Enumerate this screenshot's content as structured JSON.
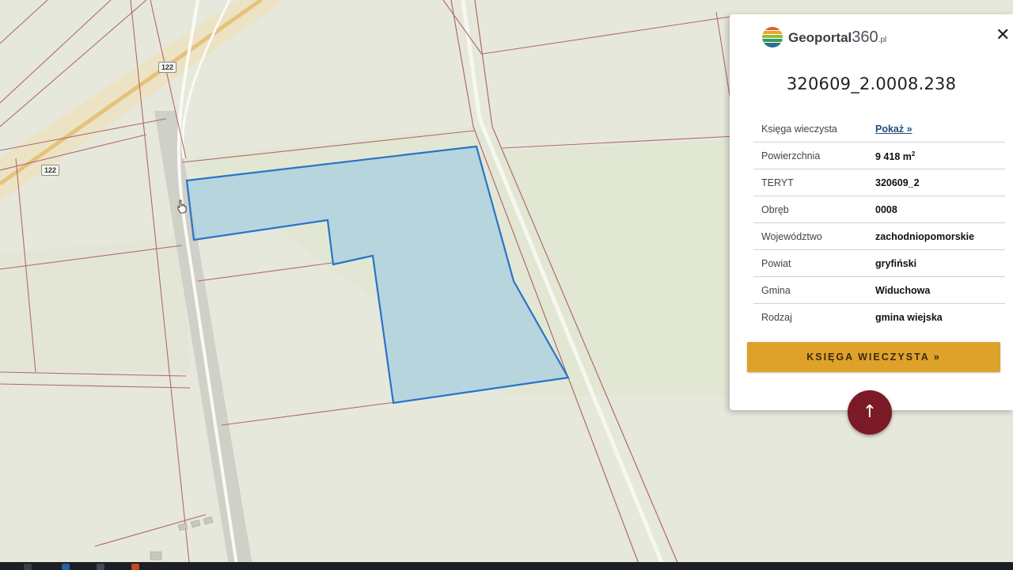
{
  "map": {
    "road_number": "122",
    "colors": {
      "land": "#e7e9dc",
      "field": "#e1e6d2",
      "parcel_line": "#b06a72",
      "road_fill": "#cfcfc8",
      "road_white": "#fbfbf7",
      "main_road": "#e9c98a",
      "selection_fill": "#a7cfe0",
      "selection_stroke": "#2a73c8"
    }
  },
  "panel": {
    "logo": {
      "name": "Geoportal",
      "suffix": "360",
      "tld": ".pl"
    },
    "close_icon": "close-icon",
    "parcel_id": "320609_2.0008.238",
    "properties": [
      {
        "label": "Księga wieczysta",
        "value": "Pokaż »",
        "link": true
      },
      {
        "label": "Powierzchnia",
        "value": "9 418 m",
        "sup": "2"
      },
      {
        "label": "TERYT",
        "value": "320609_2"
      },
      {
        "label": "Obręb",
        "value": "0008"
      },
      {
        "label": "Województwo",
        "value": "zachodniopomorskie"
      },
      {
        "label": "Powiat",
        "value": "gryfiński"
      },
      {
        "label": "Gmina",
        "value": "Widuchowa"
      },
      {
        "label": "Rodzaj",
        "value": "gmina wiejska"
      }
    ],
    "kw_button": "KSIĘGA WIECZYSTA »",
    "accent": "#dea12a"
  },
  "scroll_top_button": {
    "icon": "arrow-up-icon",
    "glyph": "↑",
    "color": "#7b1a26"
  }
}
